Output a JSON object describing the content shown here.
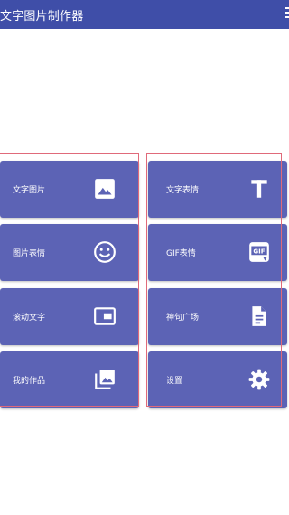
{
  "app": {
    "title": "文字图片制作器"
  },
  "tiles": [
    {
      "label": "文字图片",
      "icon": "image-icon"
    },
    {
      "label": "文字表情",
      "icon": "text-icon"
    },
    {
      "label": "图片表情",
      "icon": "smiley-icon"
    },
    {
      "label": "GIF表情",
      "icon": "gif-icon"
    },
    {
      "label": "滚动文字",
      "icon": "picture-in-picture-icon"
    },
    {
      "label": "神句广场",
      "icon": "document-icon"
    },
    {
      "label": "我的作品",
      "icon": "photo-library-icon"
    },
    {
      "label": "设置",
      "icon": "gear-icon"
    }
  ],
  "colors": {
    "appbar": "#3f4ea8",
    "tile": "#5c63b5",
    "outline": "#e06a7a"
  }
}
